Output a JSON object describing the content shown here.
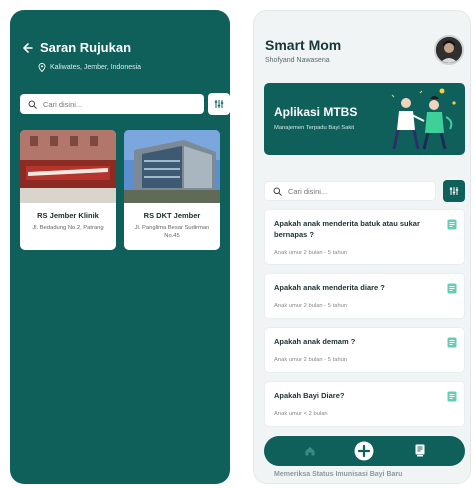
{
  "left_screen": {
    "title": "Saran Rujukan",
    "location": "Kaliwates, Jember, Indonesia",
    "search": {
      "placeholder": "Cari disini..."
    },
    "hospitals": [
      {
        "name": "RS Jember Klinik",
        "address": "Jl. Bedadung No.2, Patrang"
      },
      {
        "name": "RS DKT Jember",
        "address": "Jl. Panglima Besar Sudirman No.45"
      }
    ]
  },
  "right_screen": {
    "app_title": "Smart Mom",
    "user_name": "Shofyand Nawasena",
    "banner": {
      "title": "Aplikasi MTBS",
      "subtitle": "Manajemen Terpadu Bayi Sakit"
    },
    "search": {
      "placeholder": "Cari disini..."
    },
    "questions": [
      {
        "title": "Apakah anak menderita batuk atau sukar bernapas ?",
        "subtitle": "Anak umur 2 bulan - 5 tahun"
      },
      {
        "title": "Apakah anak menderita diare ?",
        "subtitle": "Anak umur 2 bulan - 5 tahun"
      },
      {
        "title": "Apakah anak demam ?",
        "subtitle": "Anak umur 2 bulan - 5 tahun"
      },
      {
        "title": "Apakah Bayi Diare?",
        "subtitle": "Anak umur < 2 bulan"
      }
    ],
    "partial_item_text": "Memeriksa Status Imunisasi Bayi Baru"
  },
  "colors": {
    "primary": "#0f5f5a",
    "accent_icon": "#5fd0b4",
    "card_bg": "#ffffff",
    "screen_bg": "#f1f4f4"
  },
  "icons": {
    "back": "arrow-left-icon",
    "location": "map-pin-icon",
    "search": "search-icon",
    "filter": "sliders-icon",
    "question": "clipboard-icon",
    "nav_home": "home-icon",
    "nav_add": "plus-circle-icon",
    "nav_book": "book-icon"
  }
}
